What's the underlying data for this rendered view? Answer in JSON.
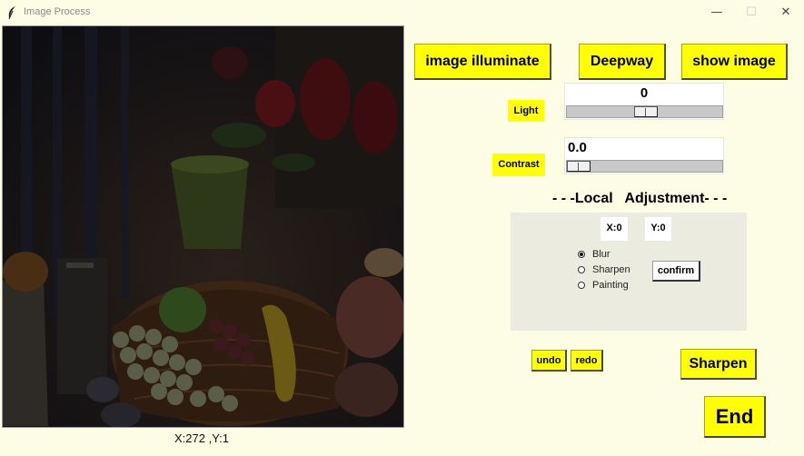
{
  "window": {
    "title": "Image Process",
    "minimize_glyph": "—",
    "maximize_glyph": "☐",
    "close_glyph": "✕"
  },
  "canvas": {
    "coords_text": "X:272 ,Y:1",
    "description_icon": "photo-still-life-dark"
  },
  "toolbar": {
    "illuminate_label": "image illuminate",
    "deepway_label": "Deepway",
    "show_label": "show image"
  },
  "light": {
    "label": "Light",
    "value": "0",
    "level": 0.51
  },
  "contrast": {
    "label": "Contrast",
    "value": "0.0",
    "level": 0.0
  },
  "local": {
    "title": "- - -Local   Adjustment- - -",
    "x_label": "X:0",
    "y_label": "Y:0",
    "options": [
      {
        "label": "Blur",
        "selected": true
      },
      {
        "label": "Sharpen",
        "selected": false
      },
      {
        "label": "Painting",
        "selected": false
      }
    ],
    "confirm_label": "confirm"
  },
  "actions": {
    "undo_label": "undo",
    "redo_label": "redo",
    "sharpen_label": "Sharpen",
    "end_label": "End"
  },
  "colors": {
    "background": "#fdfde6",
    "button_yellow": "#ffff00",
    "panel": "#ecebdf"
  }
}
